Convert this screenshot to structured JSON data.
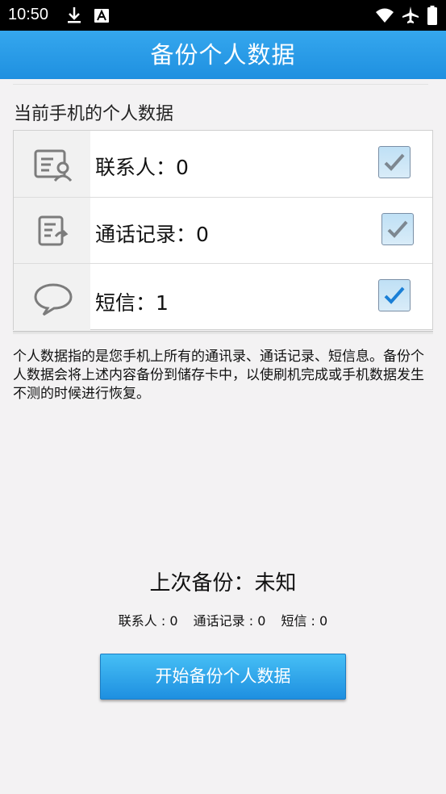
{
  "status_bar": {
    "time": "10:50",
    "icons": [
      "download-icon",
      "font-a-icon",
      "wifi-icon",
      "airplane-icon",
      "battery-icon"
    ]
  },
  "app_bar": {
    "title": "备份个人数据"
  },
  "section": {
    "title": "当前手机的个人数据"
  },
  "items": [
    {
      "label": "联系人：0",
      "icon": "contacts-icon",
      "checked": true
    },
    {
      "label": "通话记录：0",
      "icon": "call-log-icon",
      "checked": true
    },
    {
      "label": "短信：1",
      "icon": "message-icon",
      "checked": true
    }
  ],
  "description": "个人数据指的是您手机上所有的通讯录、通话记录、短信息。备份个人数据会将上述内容备份到储存卡中，以使刷机完成或手机数据发生不测的时候进行恢复。",
  "last_backup": {
    "title": "上次备份：未知",
    "counts": [
      "联系人 : 0",
      "通话记录 : 0",
      "短信 : 0"
    ]
  },
  "start_button": {
    "label": "开始备份个人数据"
  },
  "colors": {
    "app_bar": "#2b9ce8",
    "check_gray": "#7d8790",
    "check_blue": "#1a7fd6"
  }
}
